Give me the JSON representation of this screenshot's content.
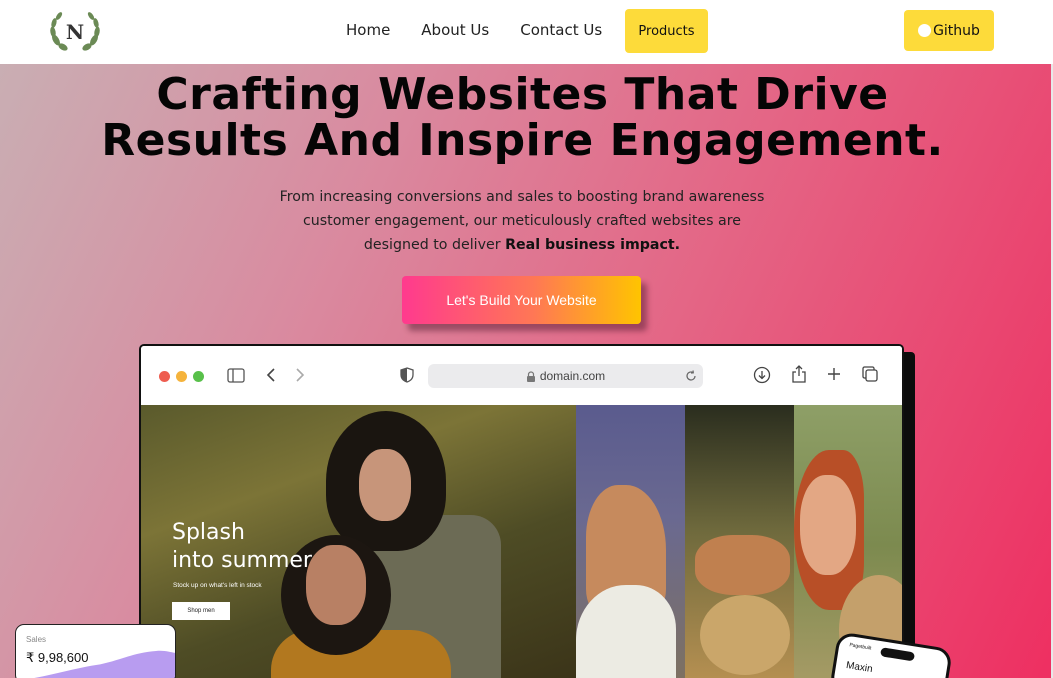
{
  "nav": {
    "logo_letter": "N",
    "links": [
      "Home",
      "About Us",
      "Contact Us"
    ],
    "products_label": "Products",
    "github_label": "Github"
  },
  "hero": {
    "headline_line1": "Crafting Websites That Drive",
    "headline_line2": "Results And Inspire Engagement.",
    "sub_line1": "From increasing conversions and sales to boosting brand awareness",
    "sub_line2": "customer engagement, our meticulously crafted websites are",
    "sub_line3_prefix": "designed to deliver ",
    "sub_line3_bold": "Real business impact.",
    "cta_label": "Let's Build Your Website"
  },
  "browser": {
    "url": "domain.com",
    "icons": [
      "sidebar-icon",
      "back-icon",
      "forward-icon",
      "shield-icon",
      "lock-icon",
      "reload-icon",
      "download-icon",
      "share-icon",
      "new-tab-icon",
      "tabs-icon"
    ]
  },
  "site": {
    "splash_line1": "Splash",
    "splash_line2": "into summer",
    "stock_text": "Stock up on what's left in stock",
    "shop_label": "Shop men"
  },
  "sales_card": {
    "label": "Sales",
    "value": "₹ 9,98,600"
  },
  "phone": {
    "brand": "Pagetbuilt",
    "title": "Maxin"
  },
  "colors": {
    "accent_yellow": "#fddb3a",
    "cta_start": "#ff3a8e",
    "cta_end": "#ffc400",
    "hero_end": "#ee2f61"
  }
}
